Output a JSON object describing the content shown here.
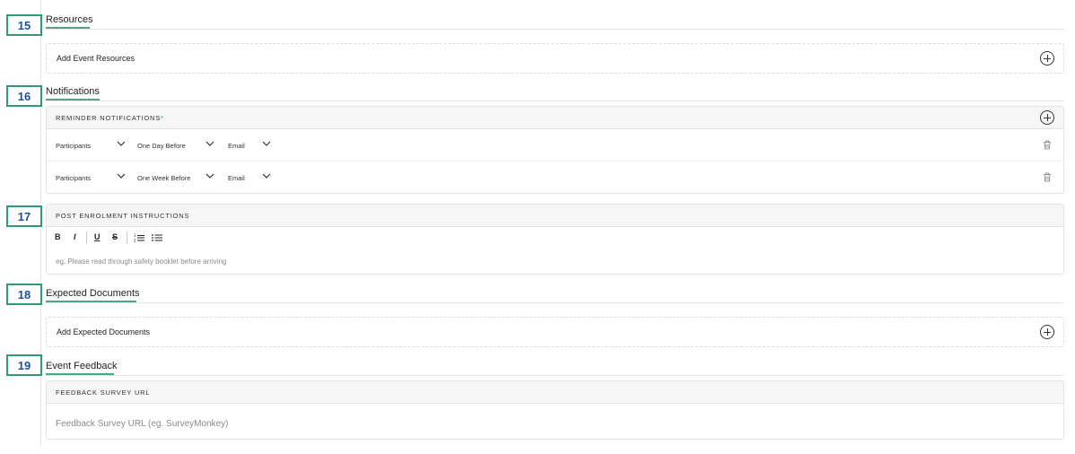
{
  "sections": {
    "resources": {
      "number": "15",
      "title": "Resources",
      "add_label": "Add Event Resources"
    },
    "notifications": {
      "number": "16",
      "title": "Notifications",
      "panel_caption": "REMINDER NOTIFICATIONS",
      "required_marker": "*",
      "rows": [
        {
          "recipient": "Participants",
          "timing": "One Day Before",
          "channel": "Email"
        },
        {
          "recipient": "Participants",
          "timing": "One Week Before",
          "channel": "Email"
        }
      ]
    },
    "post_enrolment": {
      "number": "17",
      "panel_caption": "POST ENROLMENT INSTRUCTIONS",
      "toolbar": {
        "bold": "B",
        "italic": "I",
        "underline": "U",
        "strike": "S"
      },
      "placeholder": "eg. Please read through safety booklet before arriving"
    },
    "expected_documents": {
      "number": "18",
      "title": "Expected Documents",
      "add_label": "Add Expected Documents"
    },
    "event_feedback": {
      "number": "19",
      "title": "Event Feedback",
      "panel_caption": "FEEDBACK SURVEY URL",
      "placeholder": "Feedback Survey URL (eg. SurveyMonkey)"
    }
  },
  "colors": {
    "accent": "#2f9a7a",
    "callout_text": "#1f4f9e",
    "panel_header_bg": "#f6f6f6"
  },
  "icons": {
    "add": "plus-circle-icon",
    "delete": "trash-icon",
    "dropdown": "chevron-down-icon",
    "ordered_list": "ordered-list-icon",
    "bullet_list": "bullet-list-icon"
  }
}
